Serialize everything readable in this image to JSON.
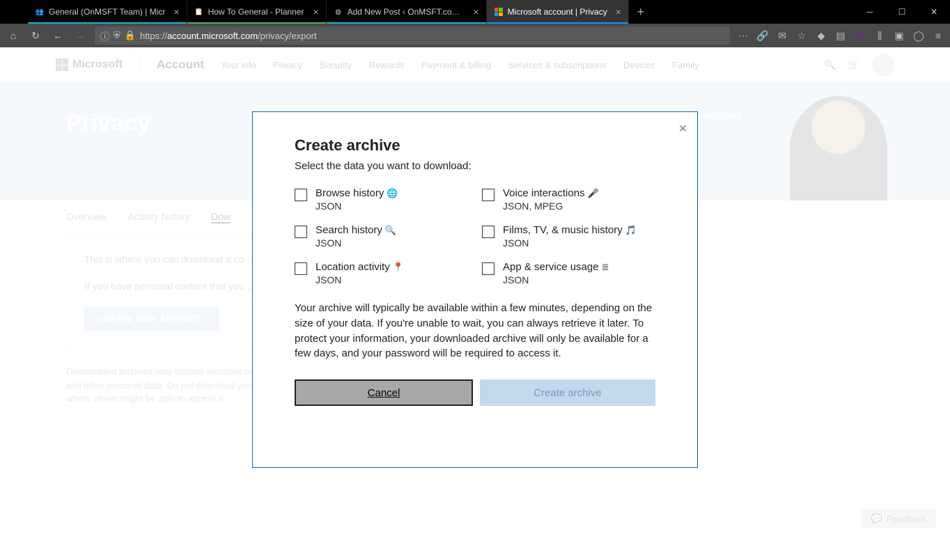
{
  "browser": {
    "tabs": [
      {
        "title": "General (OnMSFT Team) | Micr"
      },
      {
        "title": "How To General - Planner"
      },
      {
        "title": "Add New Post ‹ OnMSFT.com — W"
      },
      {
        "title": "Microsoft account | Privacy"
      }
    ],
    "url_prefix": "https://",
    "url_domain": "account.microsoft.com",
    "url_path": "/privacy/export"
  },
  "header": {
    "brand": "Microsoft",
    "account": "Account",
    "links": [
      "Your info",
      "Privacy",
      "Security",
      "Rewards",
      "Payment & billing",
      "Services & subscriptions",
      "Devices",
      "Family"
    ]
  },
  "hero": {
    "title": "Privacy",
    "blurb": "controlled"
  },
  "page_tabs": [
    "Overview",
    "Activity history",
    "Dow"
  ],
  "card": {
    "p1": "This is where you can download a co ... history page.",
    "p2": "If you have personal content that you ... your email, calendar and photos – yo",
    "btn": "CREATE NEW ARCHIVE"
  },
  "note": "Downloaded archives may contain sensitive content, such as your search history, location information and other personal data. Do not download your archive to a public computer or any other location where others might be able to access it.",
  "feedback": "Feedback",
  "modal": {
    "title": "Create archive",
    "subtitle": "Select the data you want to download:",
    "opts": [
      {
        "label": "Browse history",
        "icon": "🌐",
        "fmt": "JSON"
      },
      {
        "label": "Voice interactions",
        "icon": "🎤",
        "fmt": "JSON, MPEG"
      },
      {
        "label": "Search history",
        "icon": "🔍",
        "fmt": "JSON"
      },
      {
        "label": "Films, TV, & music history",
        "icon": "🎵",
        "fmt": "JSON"
      },
      {
        "label": "Location activity",
        "icon": "📍",
        "fmt": "JSON"
      },
      {
        "label": "App & service usage",
        "icon": "≣",
        "fmt": "JSON"
      }
    ],
    "desc": "Your archive will typically be available within a few minutes, depending on the size of your data. If you're unable to wait, you can always retrieve it later. To protect your information, your downloaded archive will only be available for a few days, and your password will be required to access it.",
    "cancel": "Cancel",
    "create": "Create archive"
  }
}
